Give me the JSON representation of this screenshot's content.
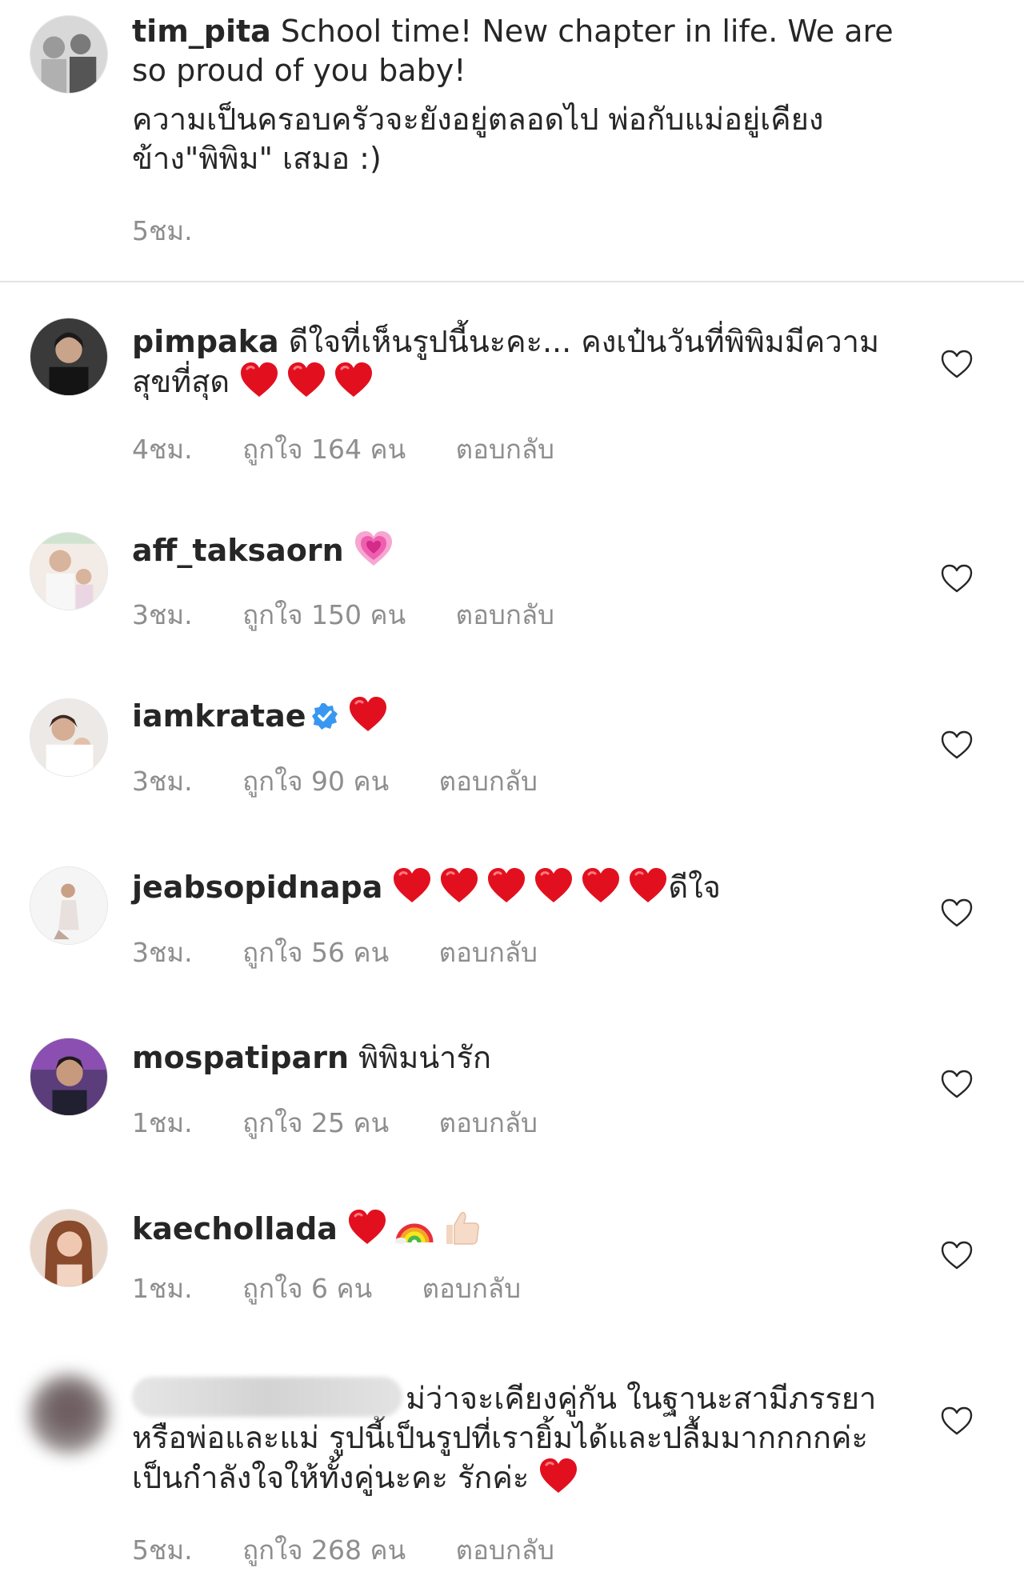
{
  "caption": {
    "username": "tim_pita",
    "text_en": "School time! New chapter in life. We are so proud of you baby!",
    "text_th": "ความเป็นครอบครัวจะยังอยู่ตลอดไป พ่อกับแม่อยู่เคียงข้าง\"พิพิม\" เสมอ :)",
    "time": "5ชม."
  },
  "comments": [
    {
      "username": "pimpaka",
      "text": "ดีใจที่เห็นรูปนี้นะคะ... คงเป๋นวันที่พิพิมมีความสุขที่สุด",
      "time": "4ชม.",
      "likes": "ถูกใจ 164 คน",
      "reply": "ตอบกลับ"
    },
    {
      "username": "aff_taksaorn",
      "text": "",
      "time": "3ชม.",
      "likes": "ถูกใจ 150 คน",
      "reply": "ตอบกลับ"
    },
    {
      "username": "iamkratae",
      "text": "",
      "time": "3ชม.",
      "likes": "ถูกใจ 90 คน",
      "reply": "ตอบกลับ"
    },
    {
      "username": "jeabsopidnapa",
      "text": "ดีใจ",
      "time": "3ชม.",
      "likes": "ถูกใจ 56 คน",
      "reply": "ตอบกลับ"
    },
    {
      "username": "mospatiparn",
      "text": "พิพิมน่ารัก",
      "time": "1ชม.",
      "likes": "ถูกใจ 25 คน",
      "reply": "ตอบกลับ"
    },
    {
      "username": "kaechollada",
      "text": "",
      "time": "1ชม.",
      "likes": "ถูกใจ 6 คน",
      "reply": "ตอบกลับ"
    },
    {
      "username": "",
      "text": "ม่ว่าจะเคียงคู่กัน ในฐานะสามีภรรยาหรือพ่อและแม่ รูปนี้เป็นรูปที่เรายิ้มได้และปลื้มมากกกกค่ะ เป็นกำลังใจให้ทั้งคู่นะคะ รักค่ะ",
      "time": "5ชม.",
      "likes": "ถูกใจ 268 คน",
      "reply": "ตอบกลับ"
    }
  ],
  "icons": {
    "like": "heart-outline-icon",
    "red_heart": "red-heart-emoji",
    "pink_heart": "growing-heart-emoji",
    "rainbow": "rainbow-emoji",
    "thumbs": "thumbs-up-emoji",
    "verified": "verified-badge-icon"
  },
  "colors": {
    "text": "#262626",
    "meta": "#8e8e8e",
    "heart": "#e2101f",
    "verified": "#3897f0"
  }
}
